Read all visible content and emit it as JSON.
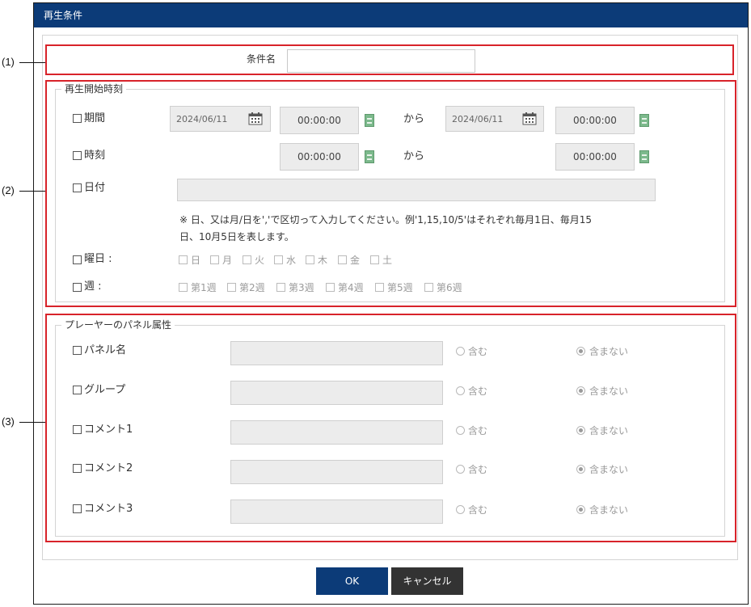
{
  "dialog": {
    "title": "再生条件"
  },
  "callouts": [
    "(1)",
    "(2)",
    "(3)"
  ],
  "condition_name": {
    "label": "条件名",
    "value": ""
  },
  "start_time": {
    "legend": "再生開始時刻",
    "period": {
      "label": "期間",
      "from_date": "2024/06/11",
      "from_time": "00:00:00",
      "kara": "から",
      "to_date": "2024/06/11",
      "to_time": "00:00:00"
    },
    "time": {
      "label": "時刻",
      "from_time": "00:00:00",
      "kara": "から",
      "to_time": "00:00:00"
    },
    "date": {
      "label": "日付",
      "value": "",
      "note_line1": "※ 日、又は月/日を','で区切って入力してください。例'1,15,10/5'はそれぞれ毎月1日、毎月15",
      "note_line2": "日、10月5日を表します。"
    },
    "weekday": {
      "label": "曜日 :",
      "days": [
        "日",
        "月",
        "火",
        "水",
        "木",
        "金",
        "土"
      ]
    },
    "week": {
      "label": "週 :",
      "weeks": [
        "第1週",
        "第2週",
        "第3週",
        "第4週",
        "第5週",
        "第6週"
      ]
    }
  },
  "panel_attrs": {
    "legend": "プレーヤーのパネル属性",
    "include_label": "含む",
    "exclude_label": "含まない",
    "rows": [
      {
        "label": "パネル名",
        "value": ""
      },
      {
        "label": "グループ",
        "value": ""
      },
      {
        "label": "コメント1",
        "value": ""
      },
      {
        "label": "コメント2",
        "value": ""
      },
      {
        "label": "コメント3",
        "value": ""
      }
    ]
  },
  "buttons": {
    "ok": "OK",
    "cancel": "キャンセル"
  },
  "colors": {
    "titlebar": "#0c3b78",
    "highlight": "#d8232a",
    "ok_button": "#0c3b78",
    "cancel_button": "#333333"
  }
}
